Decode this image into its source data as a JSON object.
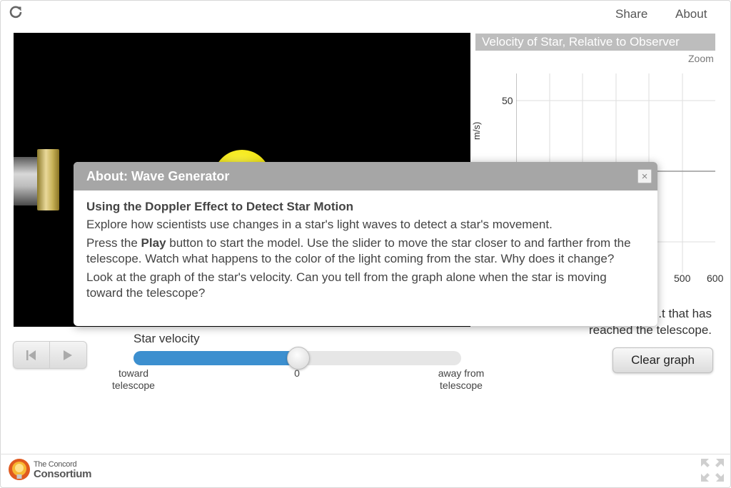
{
  "header": {
    "reload_icon": "reload-icon",
    "share_label": "Share",
    "about_label": "About"
  },
  "graph": {
    "title": "Velocity of Star, Relative to Observer",
    "zoom_label": "Zoom",
    "y_tick": "50",
    "y_axis_label_partial": "m/s)",
    "x_ticks": [
      "500",
      "600"
    ],
    "note_line1": "...t that has",
    "note_line2": "reached the telescope."
  },
  "controls": {
    "reset_icon": "skip-back-icon",
    "play_icon": "play-icon",
    "clear_graph_label": "Clear graph"
  },
  "slider": {
    "label": "Star velocity",
    "value_fraction": 0.5,
    "left_label_line1": "toward",
    "left_label_line2": "telescope",
    "center_label": "0",
    "right_label_line1": "away from",
    "right_label_line2": "telescope"
  },
  "modal": {
    "title": "About: Wave Generator",
    "close_label": "×",
    "heading": "Using the Doppler Effect to Detect Star Motion",
    "p1": "Explore how scientists use changes in a star's light waves to detect a star's movement.",
    "p2_prefix": "Press the ",
    "p2_bold": "Play",
    "p2_suffix": " button to start the model. Use the slider to move the star closer to and farther from the telescope. Watch what happens to the color of the light coming from the star. Why does it change?",
    "p3": "Look at the graph of the star's velocity. Can you tell from the graph alone when the star is moving toward the telescope?"
  },
  "footer": {
    "logo_line1": "The Concord",
    "logo_line2": "Consortium",
    "fullscreen_icon": "fullscreen-icon"
  },
  "colors": {
    "slider_fill": "#3c8fcf",
    "graph_title_bg": "#bdbdbd",
    "modal_header_bg": "#a6a6a6",
    "star": "#f2e40c"
  }
}
